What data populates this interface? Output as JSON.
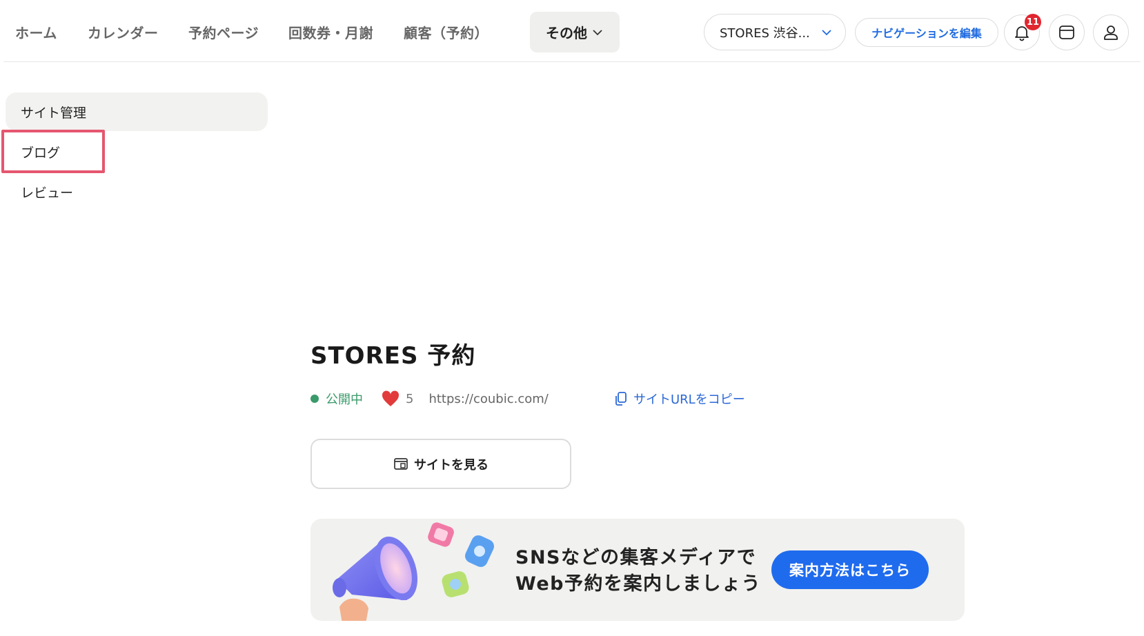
{
  "nav": {
    "items": [
      {
        "label": "ホーム"
      },
      {
        "label": "カレンダー"
      },
      {
        "label": "予約ページ"
      },
      {
        "label": "回数券・月謝"
      },
      {
        "label": "顧客（予約）"
      }
    ],
    "more_label": "その他",
    "store_select": "STORES 渋谷...",
    "edit_nav_label": "ナビゲーションを編集",
    "notification_count": "11"
  },
  "sidebar": {
    "items": [
      {
        "label": "サイト管理",
        "active": true
      },
      {
        "label": "ブログ",
        "highlighted": true
      },
      {
        "label": "レビュー"
      }
    ]
  },
  "main": {
    "title": "STORES 予約",
    "status": "公開中",
    "likes": "5",
    "url": "https://coubic.com/",
    "copy_url_label": "サイトURLをコピー",
    "view_site_label": "サイトを見る",
    "banner": {
      "line1": "SNSなどの集客メディアで",
      "line2": "Web予約を案内しましょう",
      "cta": "案内方法はこちら"
    }
  },
  "colors": {
    "accent": "#1f6bee",
    "status_green": "#3a9a6a",
    "highlight": "#e5566f",
    "badge": "#e0262f"
  }
}
